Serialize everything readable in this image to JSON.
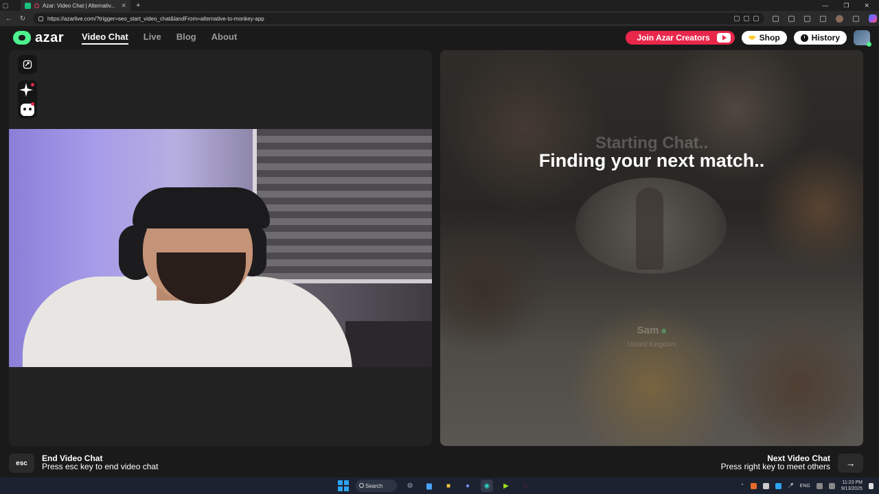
{
  "browser": {
    "tab_title": "Azar: Video Chat | Alternativ...",
    "url": "https://azarlive.com/?trigger=seo_start_video_chat&landFrom=alternative-to-monkey-app"
  },
  "site": {
    "brand": "azar",
    "nav": [
      {
        "label": "Video Chat",
        "active": true
      },
      {
        "label": "Live",
        "active": false
      },
      {
        "label": "Blog",
        "active": false
      },
      {
        "label": "About",
        "active": false
      }
    ],
    "join_creators_label": "Join Azar Creators",
    "shop_label": "Shop",
    "history_label": "History"
  },
  "match": {
    "status_faded": "Starting Chat..",
    "status": "Finding your next match..",
    "name": "Sam",
    "country": "United Kingdom"
  },
  "footer": {
    "esc_key": "esc",
    "end_title": "End Video Chat",
    "end_sub": "Press esc key to end video chat",
    "next_title": "Next Video Chat",
    "next_sub": "Press right key to meet others",
    "next_key_icon": "→"
  },
  "taskbar": {
    "search_label": "Search",
    "lang": "ENG",
    "time": "11:23 PM",
    "date": "9/13/2025"
  },
  "colors": {
    "accent_green": "#4ff08f",
    "creators_red": "#e8274b",
    "gem_yellow": "#ffcc2e"
  }
}
